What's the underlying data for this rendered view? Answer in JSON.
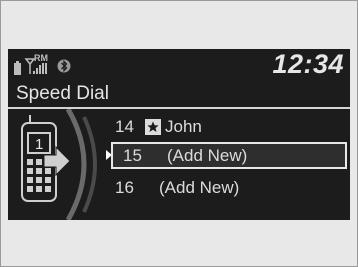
{
  "status": {
    "signal_label": "RM",
    "time": "12:34",
    "icons": [
      "battery-icon",
      "signal-icon",
      "bluetooth-icon"
    ]
  },
  "screen": {
    "title": "Speed Dial"
  },
  "illustration": {
    "speed_dial_number": "1",
    "icons": [
      "phone-icon",
      "forward-arrow-icon"
    ]
  },
  "list": {
    "items": [
      {
        "number": "14",
        "name": "John",
        "starred": true
      },
      {
        "number": "15",
        "name": "(Add New)",
        "selected": true
      },
      {
        "number": "16",
        "name": "(Add New)"
      }
    ]
  },
  "colors": {
    "background": "#1c1c1c",
    "text": "#dcdcdc",
    "highlight_border": "#e8e8e8"
  }
}
